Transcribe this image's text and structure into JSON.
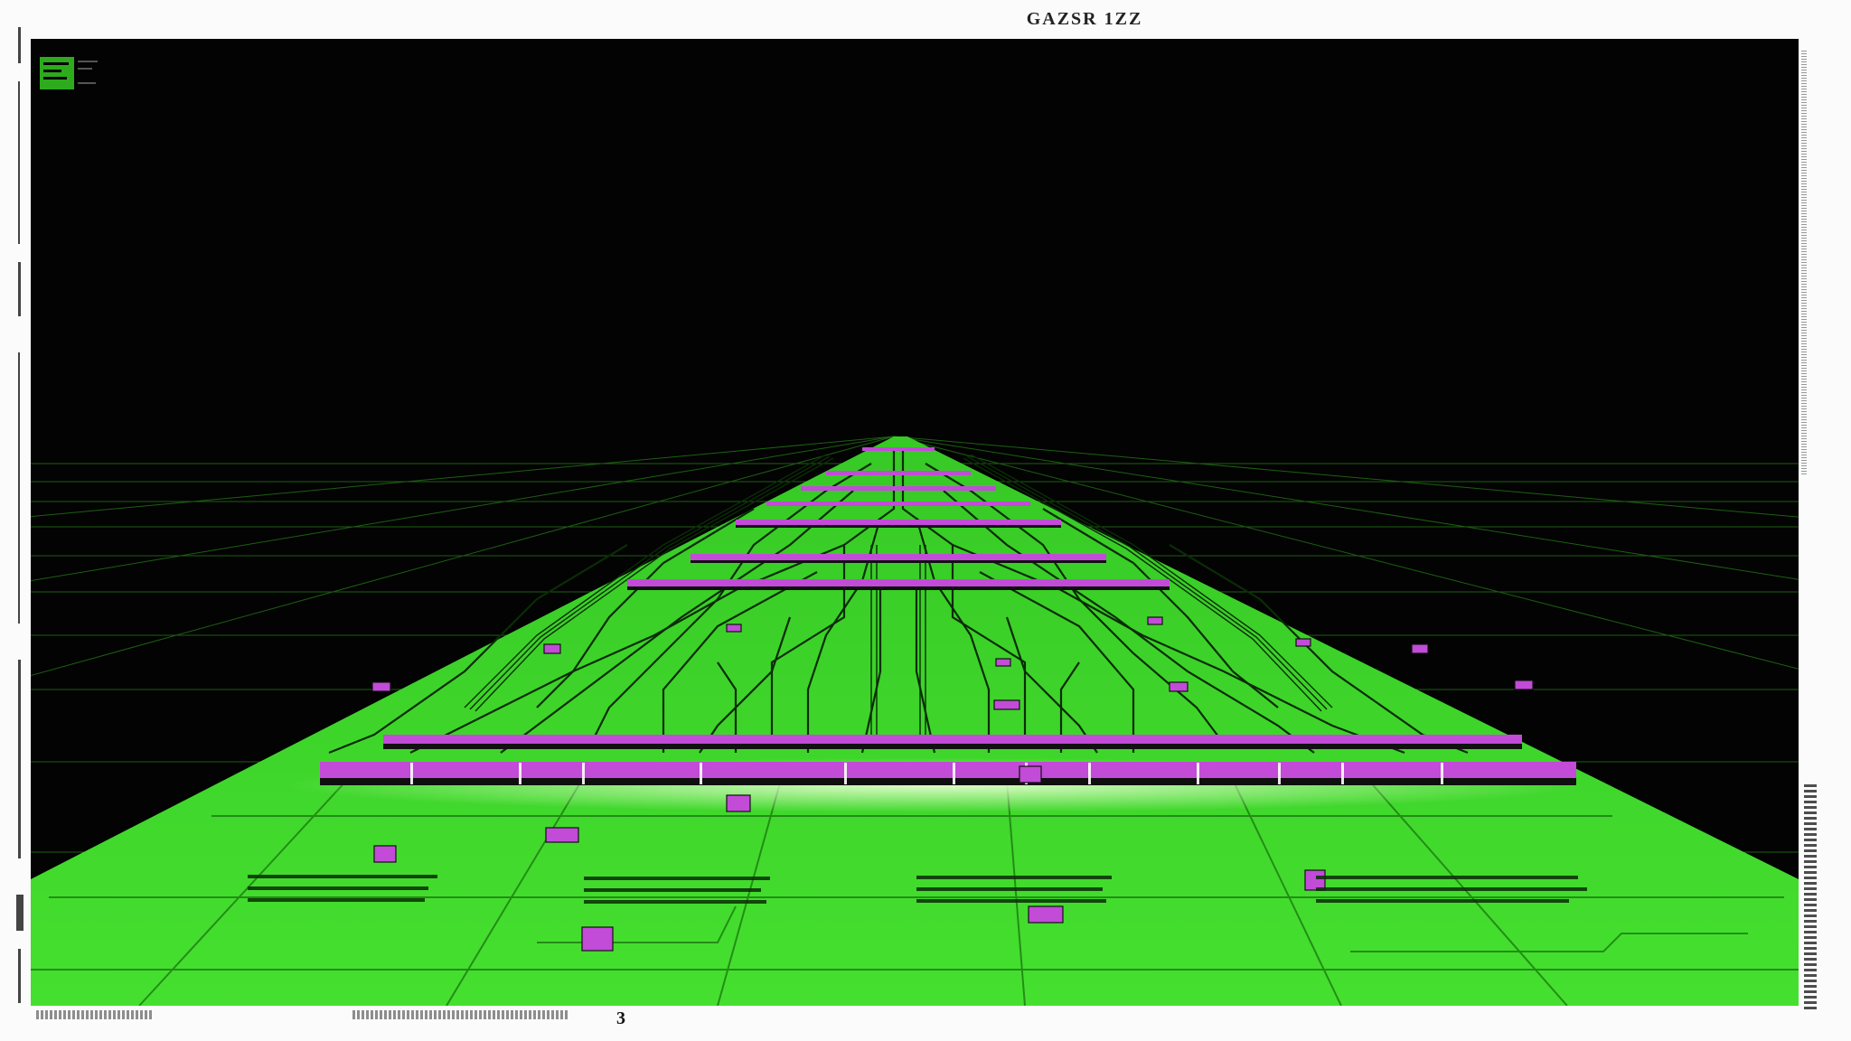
{
  "header": {
    "title": "GAZSR 1ZZ"
  },
  "footer": {
    "page_number": "3"
  },
  "colors": {
    "board_green": "#3fd92b",
    "trace_dark": "#0a2c06",
    "chip_magenta": "#c24bd8",
    "background": "#030303",
    "grid_green": "#1f6a14",
    "border": "#fbfbfb"
  }
}
